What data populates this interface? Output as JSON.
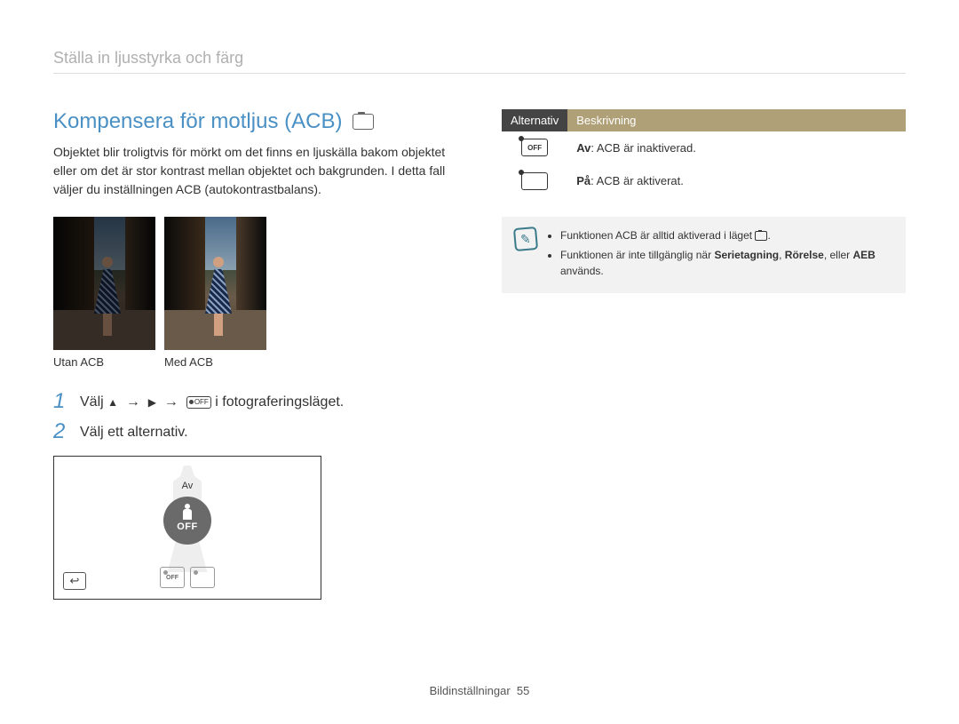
{
  "breadcrumb": "Ställa in ljusstyrka och färg",
  "title": "Kompensera för motljus (ACB)",
  "intro": "Objektet blir troligtvis för mörkt om det finns en ljuskälla bakom objektet eller om det är stor kontrast mellan objektet och bakgrunden. I detta fall väljer du inställningen ACB (autokontrastbalans).",
  "photos": {
    "without": "Utan ACB",
    "with": "Med ACB"
  },
  "steps": {
    "one_prefix": "Välj ",
    "one_suffix": " i fotograferingsläget.",
    "two": "Välj ett alternativ."
  },
  "screen": {
    "selected_label": "Av",
    "big_icon_text": "OFF",
    "thumb_off": "OFF",
    "thumb_on": ""
  },
  "table": {
    "head_option": "Alternativ",
    "head_desc": "Beskrivning",
    "rows": [
      {
        "icon_text": "OFF",
        "bold": "Av",
        "desc": ": ACB är inaktiverad."
      },
      {
        "icon_text": "",
        "bold": "På",
        "desc": ": ACB är aktiverat."
      }
    ]
  },
  "note": {
    "line1_prefix": "Funktionen ACB är alltid aktiverad i läget ",
    "line1_suffix": ".",
    "line2_prefix": "Funktionen är inte tillgänglig när ",
    "line2_bold1": "Serietagning",
    "line2_sep1": ", ",
    "line2_bold2": "Rörelse",
    "line2_sep2": ", eller ",
    "line2_bold3": "AEB",
    "line2_suffix": " används."
  },
  "footer": {
    "section": "Bildinställningar",
    "page": "55"
  }
}
